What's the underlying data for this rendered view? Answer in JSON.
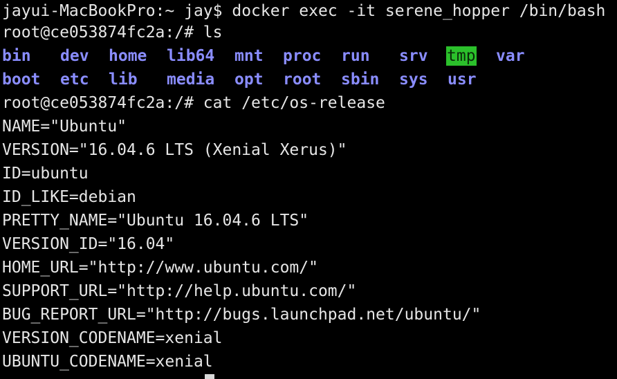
{
  "terminal": {
    "prompt_host": "jayui-MacBookPro:~ jay$ ",
    "command_exec": "docker exec -it serene_hopper /bin/bash",
    "prompt_root": "root@ce053874fc2a:/# ",
    "command_ls": "ls",
    "ls_row1": [
      "bin",
      "dev",
      "home",
      "lib64",
      "mnt",
      "proc",
      "run",
      "srv",
      "tmp",
      "var"
    ],
    "ls_row2": [
      "boot",
      "etc",
      "lib",
      "media",
      "opt",
      "root",
      "sbin",
      "sys",
      "usr"
    ],
    "highlighted_dir": "tmp",
    "command_cat": "cat /etc/os-release",
    "os_release": [
      "NAME=\"Ubuntu\"",
      "VERSION=\"16.04.6 LTS (Xenial Xerus)\"",
      "ID=ubuntu",
      "ID_LIKE=debian",
      "PRETTY_NAME=\"Ubuntu 16.04.6 LTS\"",
      "VERSION_ID=\"16.04\"",
      "HOME_URL=\"http://www.ubuntu.com/\"",
      "SUPPORT_URL=\"http://help.ubuntu.com/\"",
      "BUG_REPORT_URL=\"http://bugs.launchpad.net/ubuntu/\"",
      "VERSION_CODENAME=xenial",
      "UBUNTU_CODENAME=xenial"
    ]
  },
  "colors": {
    "background": "#000000",
    "foreground": "#e6e6e6",
    "directory": "#8a8dff",
    "highlight_bg": "#2bc02b"
  }
}
